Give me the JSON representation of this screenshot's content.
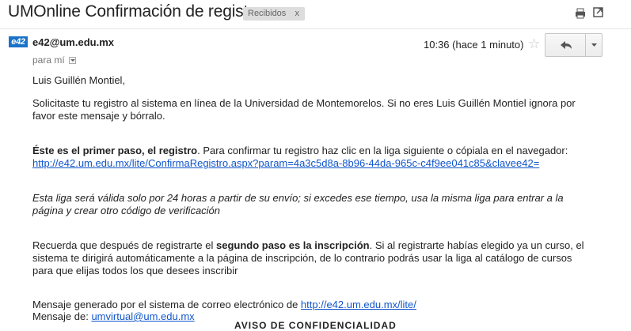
{
  "subject": "UMOnline Confirmación de registro",
  "label_chip": {
    "text": "Recibidos",
    "remove": "x"
  },
  "icons": {
    "print": "print-icon",
    "new_window": "new-window-icon",
    "star": "star-icon",
    "reply": "reply-icon",
    "more": "chevron-down-icon"
  },
  "message": {
    "avatar_text": "e42",
    "sender": "e42@um.edu.mx",
    "to_line": "para mí",
    "date": "10:36 (hace 1 minuto)"
  },
  "body": {
    "greeting": "Luis Guillén Montiel,",
    "para1_line1": "Solicitaste tu registro al sistema en línea de la Universidad de Montemorelos. Si no eres Luis Guillén Montiel ignora por",
    "para1_line2": "favor este mensaje y bórralo.",
    "step1_bold": "Éste es el primer paso, el registro",
    "step1_rest": ". Para confirmar tu registro haz clic en la liga siguiente o cópiala en el navegador:",
    "confirm_link": "http://e42.um.edu.mx/lite/ConfirmaRegistro.aspx?param=4a3c5d8a-8b96-44da-965c-c4f9ee041c85&clavee42=",
    "validity_line1": "Esta liga será válida solo por 24 horas a partir de su envío; si excedes ese tiempo, usa la misma liga para entrar a la",
    "validity_line2": "página y crear otro código de verificación",
    "rem_pre": "Recuerda que después de registrarte el ",
    "rem_bold": "segundo paso es la inscripción",
    "rem_post": ". Si al registrarte habías elegido ya un curso, el",
    "rem_line2": "sistema te dirigirá automáticamente a la página de inscripción, de lo contrario podrás usar la liga al catálogo de cursos",
    "rem_line3": "para que elijas todos los que desees inscribir",
    "generated_pre": "Mensaje generado por el sistema de correo electrónico de ",
    "generated_link": "http://e42.um.edu.mx/lite/",
    "from_pre": "Mensaje de: ",
    "from_link": "umvirtual@um.edu.mx",
    "notice_cut": "AVISO DE CONFIDENCIALIDAD"
  }
}
